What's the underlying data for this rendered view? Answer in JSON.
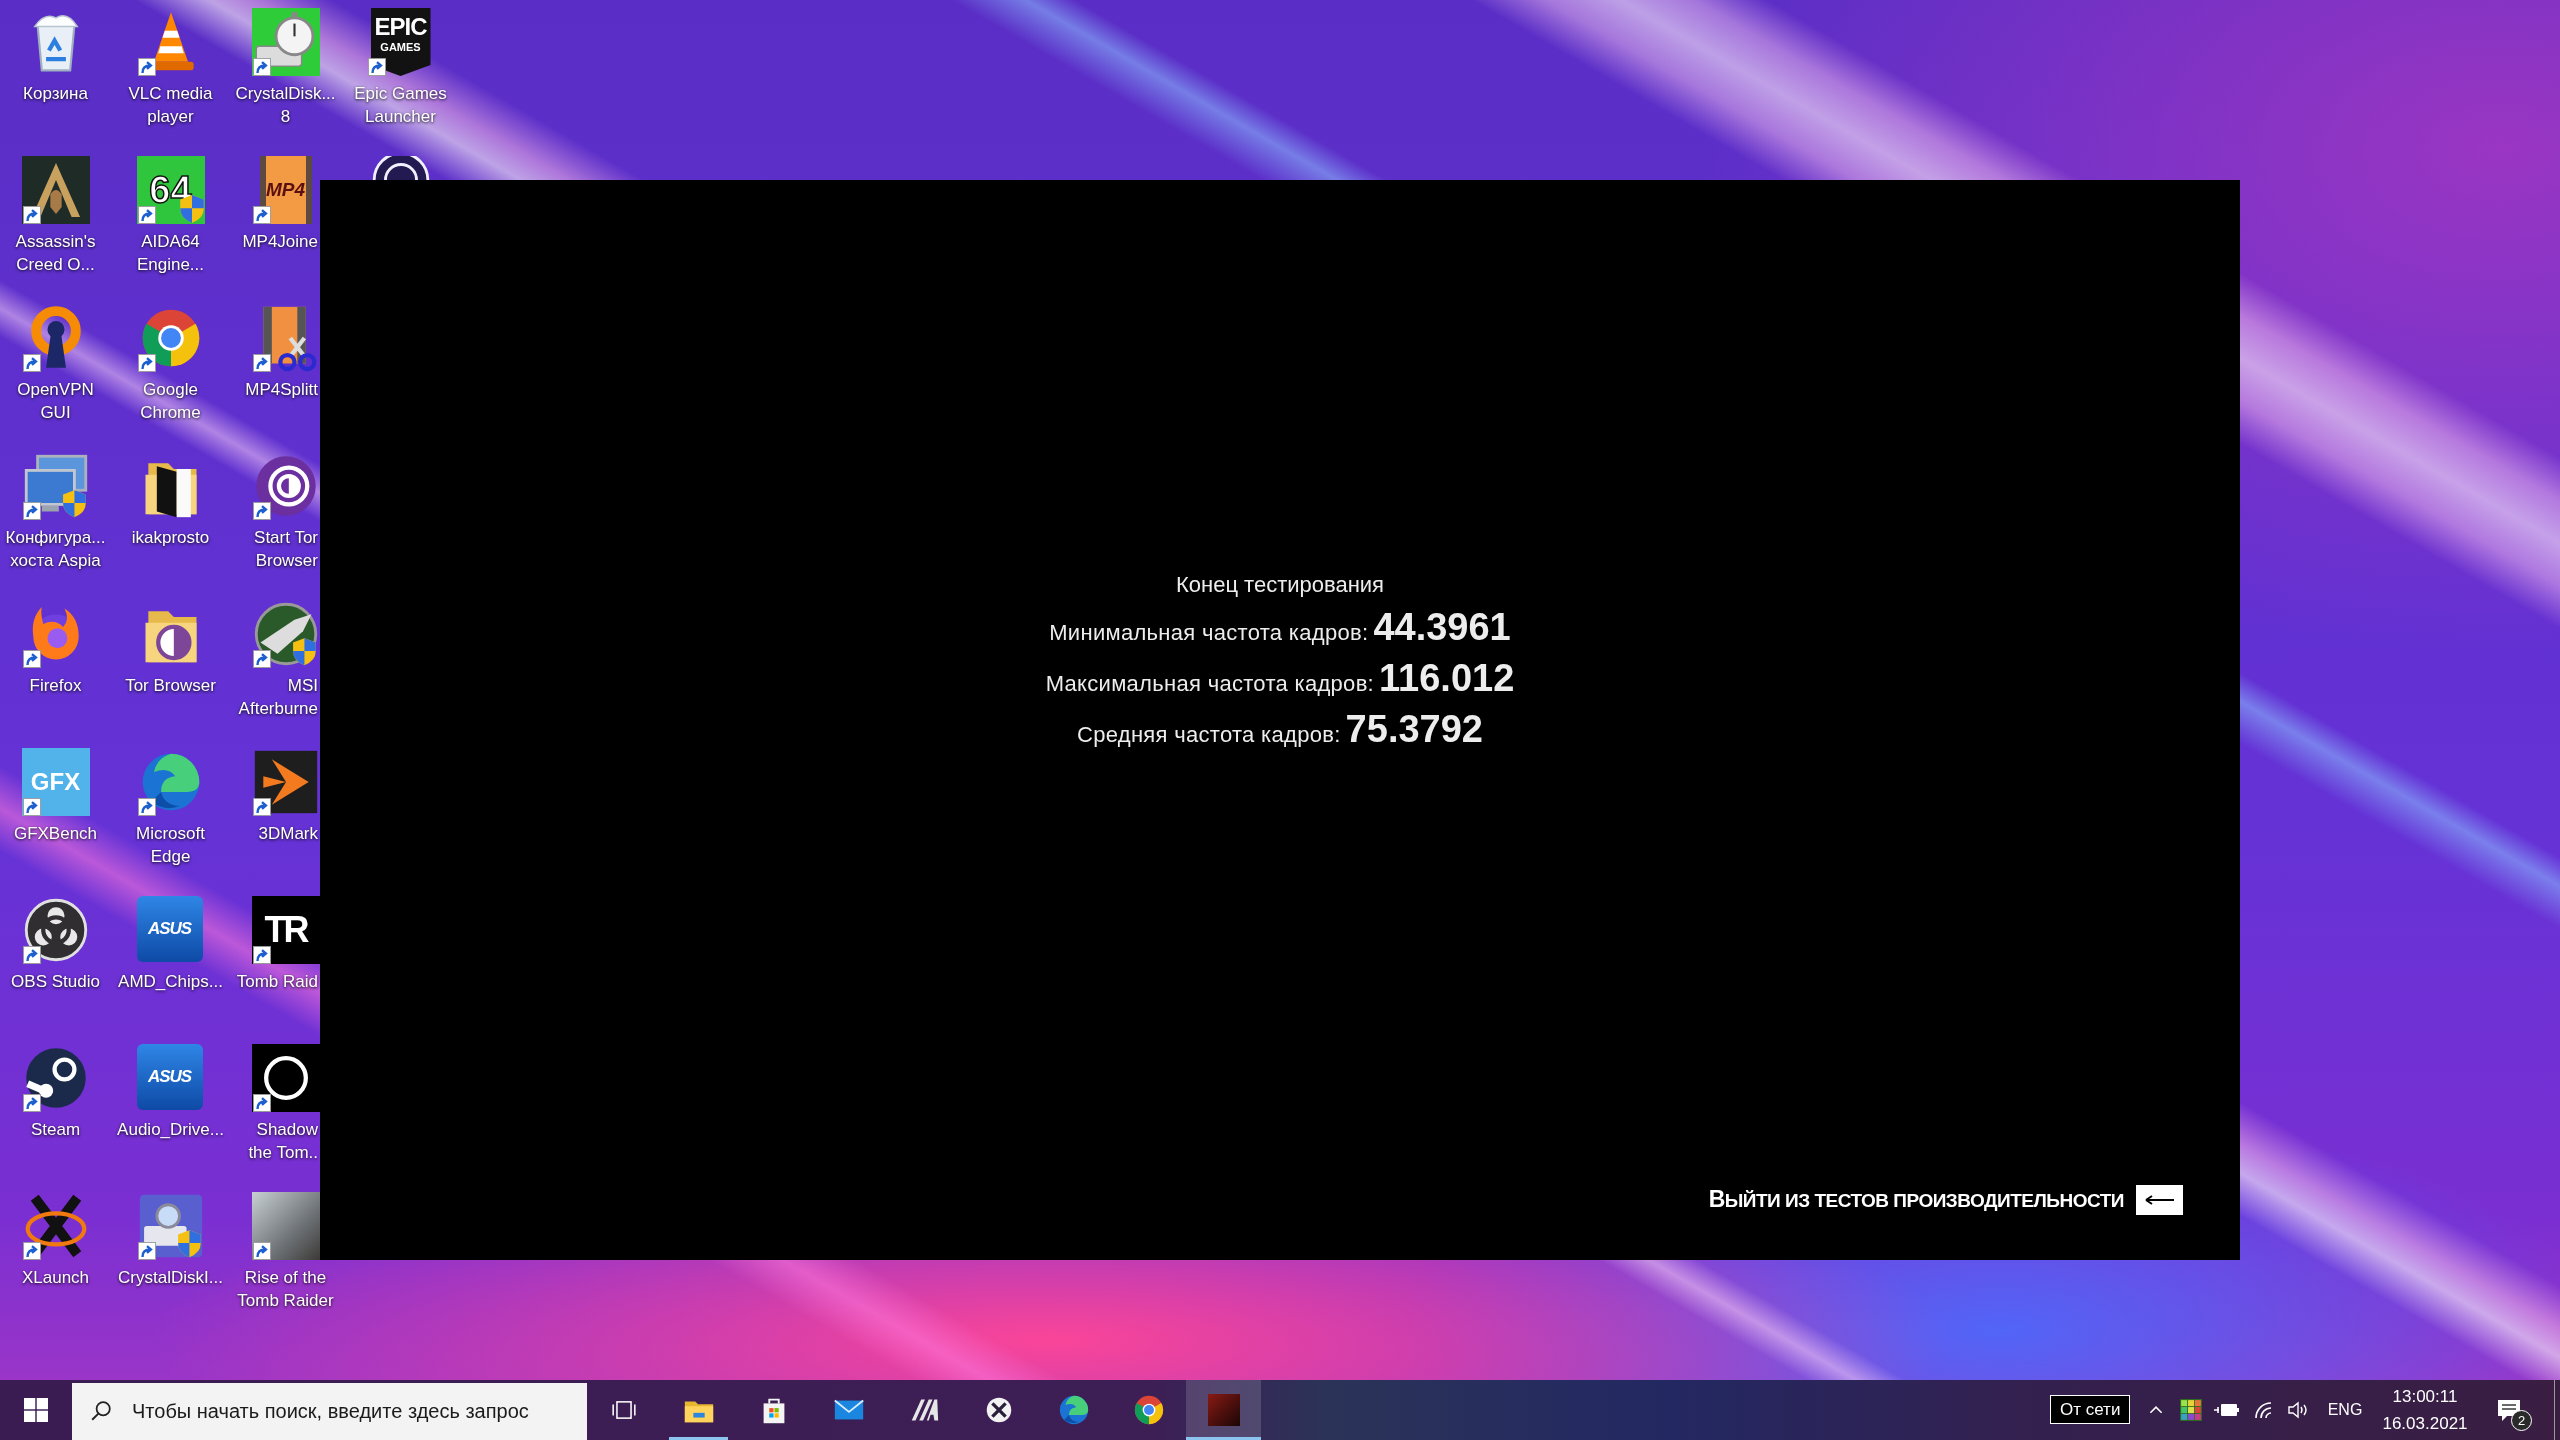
{
  "desktop": {
    "columns": [
      {
        "icons": [
          {
            "kind": "bin",
            "label": [
              "Корзина"
            ],
            "shortcut": false
          },
          {
            "kind": "emblem",
            "label": [
              "Assassin's",
              "Creed O..."
            ],
            "shortcut": true
          },
          {
            "kind": "keyhole",
            "label": [
              "OpenVPN",
              "GUI"
            ],
            "shortcut": true
          },
          {
            "kind": "monitors",
            "label": [
              "Конфигура...",
              "хоста Aspia"
            ],
            "shortcut": true
          },
          {
            "kind": "fox",
            "label": [
              "Firefox"
            ],
            "shortcut": true
          },
          {
            "kind": "gfx",
            "logo_text": [
              "GFX"
            ],
            "label": [
              "GFXBench"
            ],
            "shortcut": true
          },
          {
            "kind": "obs",
            "label": [
              "OBS Studio"
            ],
            "shortcut": true
          },
          {
            "kind": "steam",
            "label": [
              "Steam"
            ],
            "shortcut": true
          },
          {
            "kind": "x",
            "label": [
              "XLaunch"
            ],
            "shortcut": true
          }
        ]
      },
      {
        "icons": [
          {
            "kind": "cone",
            "label": [
              "VLC media",
              "player"
            ],
            "shortcut": true
          },
          {
            "kind": "aida",
            "logo_text": [
              "64"
            ],
            "label": [
              "AIDA64",
              "Engine..."
            ],
            "shortcut": true
          },
          {
            "kind": "chrome",
            "label": [
              "Google",
              "Chrome"
            ],
            "shortcut": true
          },
          {
            "kind": "door",
            "label": [
              "ikakprosto"
            ],
            "shortcut": false
          },
          {
            "kind": "torfolder",
            "label": [
              "Tor Browser"
            ],
            "shortcut": false
          },
          {
            "kind": "edge",
            "label": [
              "Microsoft",
              "Edge"
            ],
            "shortcut": true
          },
          {
            "kind": "asus",
            "logo_text": [
              "ASUS"
            ],
            "label": [
              "AMD_Chips..."
            ],
            "shortcut": false
          },
          {
            "kind": "asus",
            "logo_text": [
              "ASUS"
            ],
            "label": [
              "Audio_Drive..."
            ],
            "shortcut": false
          },
          {
            "kind": "diskinfo",
            "label": [
              "CrystalDiskI..."
            ],
            "shortcut": true
          }
        ]
      },
      {
        "icons": [
          {
            "kind": "diskmark",
            "label": [
              "CrystalDisk...",
              "8"
            ],
            "shortcut": true
          },
          {
            "kind": "mp4",
            "logo_text": [
              "MP4"
            ],
            "label": [
              "MP4Joine"
            ],
            "shortcut": true
          },
          {
            "kind": "mp4split",
            "label": [
              "MP4Splitt"
            ],
            "shortcut": true
          },
          {
            "kind": "onion",
            "label": [
              "Start Tor",
              "Browser"
            ],
            "shortcut": true
          },
          {
            "kind": "msi",
            "label": [
              "MSI",
              "Afterburne"
            ],
            "shortcut": true
          },
          {
            "kind": "mark3d",
            "label": [
              "3DMark"
            ],
            "shortcut": true
          },
          {
            "kind": "tr",
            "logo_text": [
              "TR"
            ],
            "label": [
              "Tomb Raid"
            ],
            "shortcut": true
          },
          {
            "kind": "ring",
            "label": [
              "Shadow",
              "the Tom.."
            ],
            "shortcut": true
          },
          {
            "kind": "photo",
            "label": [
              "Rise of the",
              "Tomb Raider"
            ],
            "shortcut": true
          }
        ]
      },
      {
        "icons": [
          {
            "kind": "epic",
            "logo_text": [
              "EPIC",
              "GAMES"
            ],
            "label": [
              "Epic Games",
              "Launcher"
            ],
            "shortcut": true
          },
          {
            "kind": "partial",
            "shortcut": false
          }
        ]
      }
    ]
  },
  "game_window": {
    "title": "Конец тестирования",
    "results": [
      {
        "label": "Минимальная частота кадров:",
        "value": "44.3961"
      },
      {
        "label": "Максимальная частота кадров:",
        "value": "116.012"
      },
      {
        "label": "Средняя частота кадров:",
        "value": "75.3792"
      }
    ],
    "exit_label": "ВЫЙТИ ИЗ ТЕСТОВ ПРОИЗВОДИТЕЛЬНОСТИ"
  },
  "taskbar": {
    "search": {
      "placeholder": "Чтобы начать поиск, введите здесь запрос"
    },
    "apps": [
      {
        "kind": "explorer",
        "running": true,
        "selected": false
      },
      {
        "kind": "store",
        "running": false,
        "selected": false
      },
      {
        "kind": "mail",
        "running": false,
        "selected": false
      },
      {
        "kind": "stripes",
        "running": false,
        "selected": false
      },
      {
        "kind": "xbox",
        "running": false,
        "selected": false
      },
      {
        "kind": "edge",
        "running": false,
        "selected": false
      },
      {
        "kind": "chrome",
        "running": false,
        "selected": false
      },
      {
        "kind": "game",
        "running": true,
        "selected": true
      }
    ],
    "tray": {
      "tooltip": "От сети",
      "language": "ENG",
      "time": "13:00:11",
      "date": "16.03.2021",
      "notification_count": "2"
    }
  }
}
